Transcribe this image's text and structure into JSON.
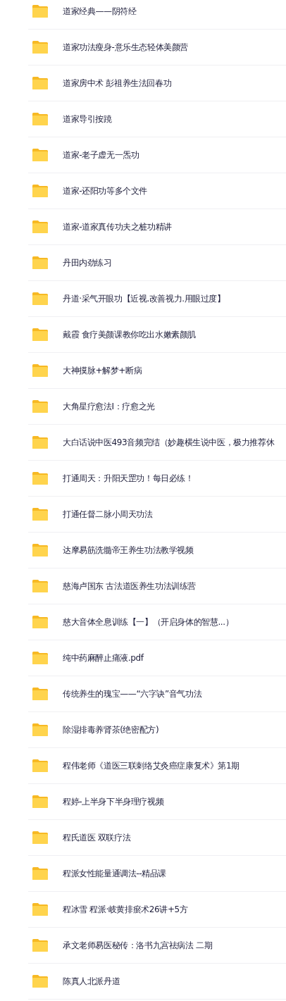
{
  "files": [
    {
      "name": "道家经典——阴符经"
    },
    {
      "name": "道家功法瘦身-意乐生态轻体美颜营"
    },
    {
      "name": "道家房中术 彭祖养生法回春功"
    },
    {
      "name": "道家导引按蹺"
    },
    {
      "name": "道家-老子虚无一炁功"
    },
    {
      "name": "道家-还阳功等多个文件"
    },
    {
      "name": "道家-道家真传功夫之桩功精讲"
    },
    {
      "name": "丹田内劲练习"
    },
    {
      "name": "丹道·采气开眼功【近视.改善视力.用眼过度】"
    },
    {
      "name": "戴霞 食疗美颜课教你吃出水嫩素颜肌"
    },
    {
      "name": "大神摸脉+解梦+断病"
    },
    {
      "name": "大角星疗愈法I：疗愈之光"
    },
    {
      "name": "大白话说中医493音频完结（妙趣横生说中医，极力推荐休"
    },
    {
      "name": "打通周天：升阳天罡功！每日必练！"
    },
    {
      "name": "打通任督二脉小周天功法"
    },
    {
      "name": "达摩易筋洗髓帝王养生功法教学视频"
    },
    {
      "name": "慈海卢国东 古法道医养生功法训练营"
    },
    {
      "name": "慈大音体全息训练【一】（开启身体的智慧...）"
    },
    {
      "name": "纯中药麻醉止痛液.pdf"
    },
    {
      "name": "传统养生的瑰宝——“六字诀”音气功法"
    },
    {
      "name": "除湿排毒养肾茶(绝密配方)"
    },
    {
      "name": "程伟老师《道医三联刺络艾灸癌症康复术》第1期"
    },
    {
      "name": "程婷-上半身下半身理疗视频"
    },
    {
      "name": "程氏道医 双联疗法"
    },
    {
      "name": "程派女性能量通调法--精品课"
    },
    {
      "name": "程冰雪 程派·岐黄排瘀术26讲+5方"
    },
    {
      "name": "承文老师易医秘传：洛书九宫祛病法 二期"
    },
    {
      "name": "陈真人北派丹道"
    }
  ]
}
